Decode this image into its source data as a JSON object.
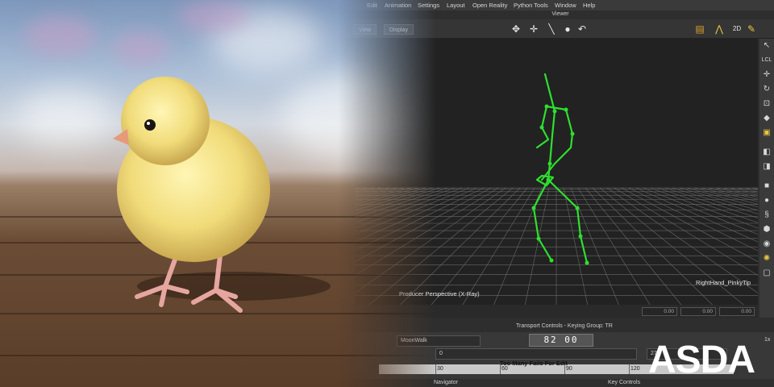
{
  "menu": [
    "Edit",
    "Animation",
    "Settings",
    "Layout",
    "Open Reality",
    "Python Tools",
    "Window",
    "Help"
  ],
  "viewer": {
    "title": "Viewer",
    "view_button": "View",
    "display_button": "Display",
    "camera_label": "Producer Perspective (X-Ray)",
    "selection_label": "RightHand_PinkyTip",
    "coord_values": [
      "0.00",
      "0.00",
      "0.00"
    ]
  },
  "transport": {
    "title": "Transport Controls  -  Keying Group: TR",
    "take": "MoonWalk",
    "frame_display": "82 00",
    "start": "0",
    "end": "27",
    "speed": "1x",
    "warning": "Too Many Fails For Edit",
    "tick_labels": [
      "30",
      "60",
      "90",
      "120"
    ]
  },
  "panels": {
    "navigator": "Navigator",
    "key_controls": "Key Controls"
  },
  "logo": {
    "text": "ASDA"
  },
  "colors": {
    "skeleton": "#2ee02e",
    "grid": "#6a6a6a",
    "viewport_bg": "#222222"
  },
  "icons": [
    "move-icon",
    "translate-icon",
    "bone-icon",
    "zoom-icon",
    "undo-icon",
    "select-arrow-icon",
    "rotate-icon",
    "scale-icon"
  ]
}
